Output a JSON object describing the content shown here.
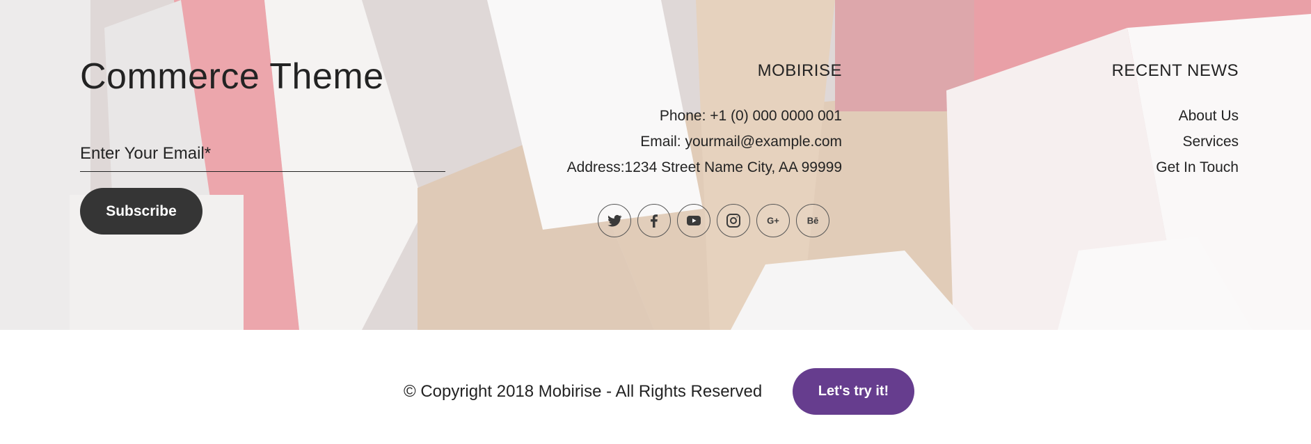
{
  "brand": {
    "title": "Commerce Theme"
  },
  "subscribe": {
    "email_placeholder": "Enter Your Email*",
    "email_value": "",
    "button_label": "Subscribe"
  },
  "mobirise": {
    "title": "MOBIRISE",
    "phone": "Phone: +1 (0) 000 0000 001",
    "email": "Email: yourmail@example.com",
    "address": "Address:1234 Street Name City, AA 99999"
  },
  "social": {
    "icons": [
      "twitter-icon",
      "facebook-icon",
      "youtube-icon",
      "instagram-icon",
      "google-plus-icon",
      "behance-icon"
    ]
  },
  "news": {
    "title": "RECENT NEWS",
    "links": [
      "About Us",
      "Services",
      "Get In Touch"
    ]
  },
  "footer": {
    "copyright": "© Copyright 2018 Mobirise - All Rights Reserved",
    "cta_label": "Let's try it!"
  },
  "colors": {
    "dark_button": "#353535",
    "accent_purple": "#663d8e",
    "text": "#232323"
  }
}
